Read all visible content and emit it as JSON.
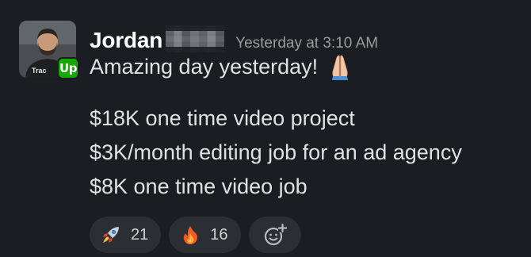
{
  "message": {
    "sender": "Jordan",
    "timestamp": "Yesterday at 3:10 AM",
    "first_line": "Amazing day yesterday!",
    "first_line_emoji": "folded-hands-icon",
    "avatar_shirt_text": "Trac",
    "app_badge": "Up",
    "lines": [
      "$18K one time video project",
      "$3K/month editing job for an ad agency",
      "$8K one time video job"
    ]
  },
  "reactions": [
    {
      "icon": "rocket-icon",
      "count": "21"
    },
    {
      "icon": "fire-icon",
      "count": "16"
    }
  ],
  "add_reaction": {
    "icon": "add-reaction-icon"
  },
  "colors": {
    "background": "#1a1d21",
    "reaction_bg": "#2b2e33",
    "badge_green": "#14a800",
    "timestamp": "#9a9b9d"
  }
}
